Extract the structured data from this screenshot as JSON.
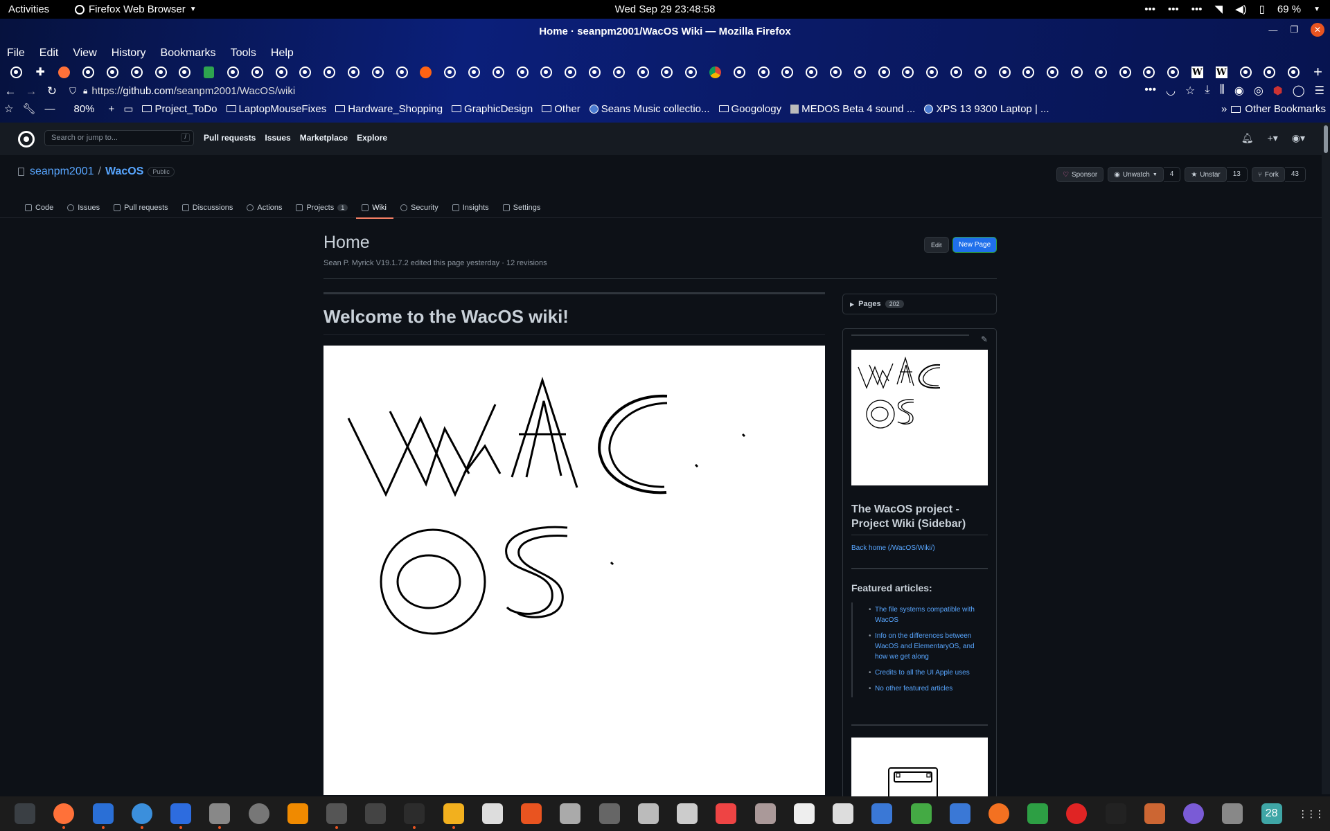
{
  "topbar": {
    "activities": "Activities",
    "app_name": "Firefox Web Browser",
    "clock": "Wed Sep 29  23:48:58",
    "battery": "69 %"
  },
  "window": {
    "title": "Home · seanpm2001/WacOS Wiki — Mozilla Firefox"
  },
  "menu": [
    "File",
    "Edit",
    "View",
    "History",
    "Bookmarks",
    "Tools",
    "Help"
  ],
  "tab_count": 54,
  "navbar": {
    "url_prefix": "https://",
    "url_domain": "github.com",
    "url_path": "/seanpm2001/WacOS/wiki",
    "zoom": "80%"
  },
  "bookmarks": [
    {
      "label": "Project_ToDo",
      "icon": "folder-icon"
    },
    {
      "label": "LaptopMouseFixes",
      "icon": "folder-icon"
    },
    {
      "label": "Hardware_Shopping",
      "icon": "folder-icon"
    },
    {
      "label": "GraphicDesign",
      "icon": "folder-icon"
    },
    {
      "label": "Other",
      "icon": "folder-icon"
    },
    {
      "label": "Seans Music collectio...",
      "icon": "globe-icon"
    },
    {
      "label": "Googology",
      "icon": "folder-icon"
    },
    {
      "label": "MEDOS Beta 4 sound ...",
      "icon": "page-icon"
    },
    {
      "label": "XPS 13 9300 Laptop | ...",
      "icon": "globe-icon"
    }
  ],
  "bookmarks_other": "Other Bookmarks",
  "github": {
    "search_placeholder": "Search or jump to...",
    "search_key": "/",
    "nav": [
      "Pull requests",
      "Issues",
      "Marketplace",
      "Explore"
    ]
  },
  "repo": {
    "owner": "seanpm2001",
    "separator": "/",
    "name": "WacOS",
    "visibility": "Public",
    "sponsor": "Sponsor",
    "watch": "Unwatch",
    "watch_count": "4",
    "star": "Unstar",
    "star_count": "13",
    "fork": "Fork",
    "fork_count": "43",
    "tabs": [
      {
        "label": "Code",
        "badge": ""
      },
      {
        "label": "Issues",
        "badge": ""
      },
      {
        "label": "Pull requests",
        "badge": ""
      },
      {
        "label": "Discussions",
        "badge": ""
      },
      {
        "label": "Actions",
        "badge": ""
      },
      {
        "label": "Projects",
        "badge": "1"
      },
      {
        "label": "Wiki",
        "badge": ""
      },
      {
        "label": "Security",
        "badge": ""
      },
      {
        "label": "Insights",
        "badge": ""
      },
      {
        "label": "Settings",
        "badge": ""
      }
    ]
  },
  "wiki": {
    "title": "Home",
    "meta": "Sean P. Myrick V19.1.7.2 edited this page yesterday · 12 revisions",
    "edit": "Edit",
    "new_page": "New Page",
    "heading": "Welcome to the WacOS wiki!"
  },
  "sidebar": {
    "pages_label": "Pages",
    "pages_count": "202",
    "title": "The WacOS project - Project Wiki (Sidebar)",
    "back_home": "Back home (/WacOS/Wiki/)",
    "featured_heading": "Featured articles:",
    "featured": [
      "The file systems compatible with WacOS",
      "Info on the differences between WacOS and ElementaryOS, and how we get along",
      "Credits to all the UI Apple uses",
      "No other featured articles"
    ]
  },
  "dock": {
    "calendar_day": "28",
    "apps": [
      "system-monitor-icon",
      "firefox-icon",
      "writer-icon",
      "help-icon",
      "text-editor-icon",
      "files-icon",
      "settings-icon",
      "vlc-icon",
      "app-icon",
      "updater-icon",
      "terminal-icon",
      "calculator-icon",
      "monitor-icon",
      "store-icon",
      "search-icon",
      "disks-icon",
      "libreoffice-icon",
      "screenshot-icon",
      "pdf-icon",
      "archive-icon",
      "character-icon",
      "font-icon",
      "tasks-icon",
      "vim-icon",
      "screen-icon",
      "backup-icon",
      "calc-icon",
      "alert-icon",
      "music-icon",
      "game-icon",
      "webcam-icon",
      "tool-icon",
      "calendar-icon",
      "app-grid-icon"
    ]
  }
}
